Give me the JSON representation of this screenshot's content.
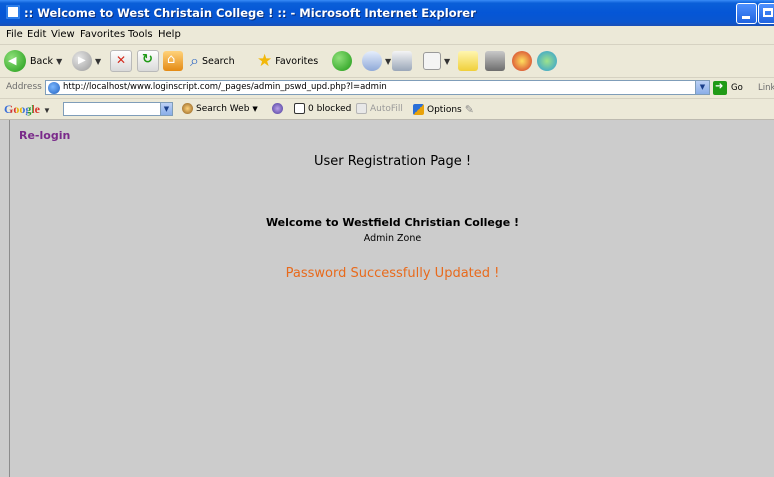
{
  "window": {
    "title": ":: Welcome to West Christain College ! :: - Microsoft Internet Explorer"
  },
  "menu": {
    "items": [
      "File",
      "Edit",
      "View",
      "Favorites",
      "Tools",
      "Help"
    ]
  },
  "toolbar": {
    "back_label": "Back",
    "search_label": "Search",
    "favorites_label": "Favorites"
  },
  "address": {
    "label": "Address",
    "url": "http://localhost/www.loginscript.com/_pages/admin_pswd_upd.php?l=admin",
    "go_label": "Go",
    "links_label": "Link"
  },
  "google_toolbar": {
    "logo": "Google",
    "search_web_label": "Search Web",
    "blocked_label": "0 blocked",
    "autofill_label": "AutoFill",
    "options_label": "Options"
  },
  "page": {
    "relogin_link": "Re-login",
    "title": "User Registration Page !",
    "welcome": "Welcome to Westfield Christian College !",
    "zone": "Admin Zone",
    "message": "Password Successfully Updated !"
  },
  "colors": {
    "titlebar_blue": "#0556d6",
    "chrome_bg": "#ece9d8",
    "page_bg": "#cccccc",
    "link_purple": "#7a2a8a",
    "message_orange": "#e86a1c"
  }
}
